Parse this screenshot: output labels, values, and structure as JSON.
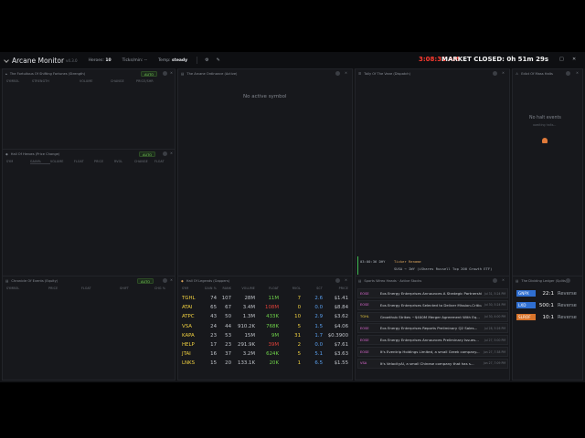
{
  "header": {
    "app_name": "Arcane Monitor",
    "version": "v4.3.0",
    "heroes_label": "Heroes:",
    "heroes_value": "10",
    "ticks_label": "Ticks/min: --",
    "temp_label": "Temp:",
    "temp_value": "steady",
    "clock": "3:08:31 AM",
    "market_status": "MARKET CLOSED: 0h 51m 29s",
    "window_controls": [
      "–",
      "□",
      "✕"
    ]
  },
  "panels": {
    "momentum": {
      "title": "The Fortuitous Of Shifting Fortunes (Strength)",
      "auto": "AUTO",
      "columns": [
        "SYMBOL",
        "STRENGTH",
        "VOLUME",
        "CHANGE",
        "PRICE",
        "PRICE/SHR"
      ]
    },
    "chart": {
      "title": "The Arcane Ordinance (Active)",
      "empty": "No active symbol"
    },
    "time_and_sales": {
      "title": "Tally Of The Vane (Dispatch)",
      "entry_time": "03:00:36 DHY",
      "entry_title": "Ticker Rename",
      "entry_text": "SUSA → IWY (iShares Russell Top 200 Growth ETF)"
    },
    "halts_top": {
      "title": "Edict Of Mass Halts",
      "empty": "No halt events",
      "empty_sub": "awaiting halts..."
    },
    "hall_of_heroes": {
      "title": "Hall Of Heroes (Price Change)",
      "auto": "AUTO",
      "columns": [
        "SYM",
        "GAIN%",
        "VOLUME",
        "FLOAT",
        "PRICE",
        "RVOL",
        "CHANGE",
        "FLOAT"
      ]
    },
    "chronicle": {
      "title": "Chronicle Of Events (Equity)",
      "auto": "AUTO",
      "columns": [
        "SYMBOL",
        "PRICE",
        "FLOAT",
        "SHIFT",
        "CHG %"
      ]
    },
    "scanner": {
      "title": "Hall Of Legends (Gappers)",
      "columns": [
        "SYM",
        "GAIN %",
        "RANK",
        "VOLUME",
        "FLOAT",
        "RVOL",
        "SCT",
        "PRICE"
      ],
      "rows": [
        {
          "sym": "TGHL",
          "gain": "74",
          "rank": "107",
          "vol": "28M",
          "float": "11M",
          "float_color": "#6fd34a",
          "rvol": "7",
          "sct": "2.6",
          "price": "$1.41"
        },
        {
          "sym": "ATAI",
          "gain": "65",
          "rank": "67",
          "vol": "3.4M",
          "float": "108M",
          "float_color": "#e0413a",
          "rvol": "0",
          "sct": "0.0",
          "price": "$8.84"
        },
        {
          "sym": "ATPC",
          "gain": "43",
          "rank": "50",
          "vol": "1.3M",
          "float": "433K",
          "float_color": "#6fd34a",
          "rvol": "10",
          "sct": "2.9",
          "price": "$3.62"
        },
        {
          "sym": "VSA",
          "gain": "24",
          "rank": "44",
          "vol": "910.2K",
          "float": "768K",
          "float_color": "#6fd34a",
          "rvol": "5",
          "sct": "1.5",
          "price": "$4.06"
        },
        {
          "sym": "KAPA",
          "gain": "23",
          "rank": "53",
          "vol": "15M",
          "float": "9M",
          "float_color": "#6fd34a",
          "rvol": "31",
          "sct": "1.7",
          "price": "$0.3900"
        },
        {
          "sym": "HELP",
          "gain": "17",
          "rank": "23",
          "vol": "291.9K",
          "float": "39M",
          "float_color": "#e0413a",
          "rvol": "2",
          "sct": "0.0",
          "price": "$7.61"
        },
        {
          "sym": "JTAI",
          "gain": "16",
          "rank": "37",
          "vol": "3.2M",
          "float": "624K",
          "float_color": "#6fd34a",
          "rvol": "5",
          "sct": "5.1",
          "price": "$3.63"
        },
        {
          "sym": "LNKS",
          "gain": "15",
          "rank": "20",
          "vol": "133.1K",
          "float": "20K",
          "float_color": "#6fd34a",
          "rvol": "1",
          "sct": "6.5",
          "price": "$1.55"
        }
      ]
    },
    "news": {
      "title": "Sports Wireo Heads · Active Stocks",
      "rows": [
        {
          "tk": "EOSE",
          "headline": "Eos Energy Enterprises Announces A Strategic Partnership...",
          "time": "Jul 31, 5:24 PM"
        },
        {
          "tk": "EOSE",
          "headline": "Eos Energy Enterprises Selected to Deliver Mission-Critical...",
          "time": "Jul 30, 5:24 PM"
        },
        {
          "tk": "TGHL",
          "headline": "Growthub Strikes ~$400M Merger Agreement With Eq...",
          "time": "Jul 30, 4:00 PM"
        },
        {
          "tk": "EOSE",
          "headline": "Eos Energy Enterprises Reports Preliminary Q2 Sales...",
          "time": "Jul 28, 5:26 PM"
        },
        {
          "tk": "EOSE",
          "headline": "Eos Energy Enterprises Announces Preliminary Issues...",
          "time": "Jul 27, 5:00 PM"
        },
        {
          "tk": "EOSE",
          "headline": "It's Eventrip Holdings Limited, a small Greek company...",
          "time": "Jun 27, 7:38 PM"
        },
        {
          "tk": "VSA",
          "headline": "It's VelocityAI, a small Chinese company that has s...",
          "time": "Jun 27, 7:09 PM"
        }
      ]
    },
    "halts": {
      "title": "The Dividing Ledger (Splits)",
      "rows": [
        {
          "tk": "GNPX",
          "color": "#2f6fd1",
          "ratio": "22:1",
          "type": "Reverse"
        },
        {
          "tk": "LXD",
          "color": "#2f6fd1",
          "ratio": "500:1",
          "type": "Reverse"
        },
        {
          "tk": "SLROF",
          "color": "#d8742b",
          "ratio": "10:1",
          "type": "Reverse"
        }
      ]
    }
  }
}
